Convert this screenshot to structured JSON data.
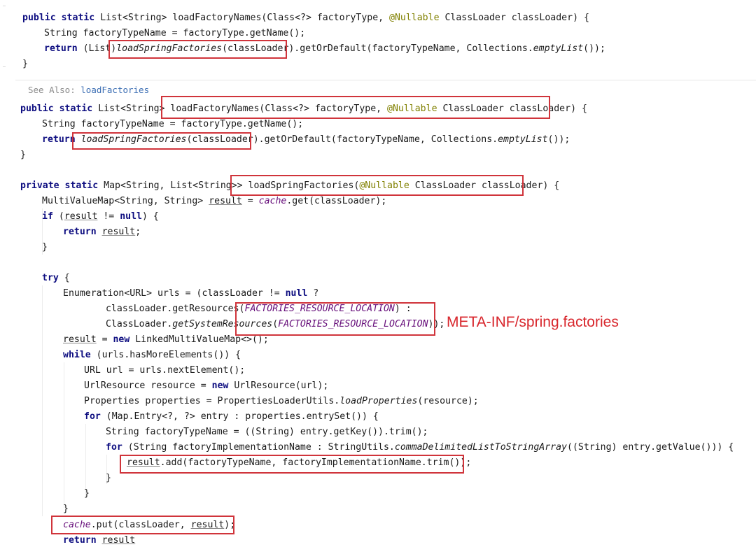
{
  "top_snippet": {
    "line1": {
      "kw1": "public",
      "kw2": "static",
      "sig_a": "List<String> loadFactoryNames(Class<?> factoryType, ",
      "ann": "@Nullable",
      "sig_b": " ClassLoader classLoader) {"
    },
    "line2": "String factoryTypeName = factoryType.getName();",
    "line3": {
      "kw": "return",
      "pre": " (List)",
      "call": "loadSpringFactories",
      "args": "(classLoader)",
      "post": ".getOrDefault(factoryTypeName, Collections.",
      "it": "emptyList",
      "end": "());"
    },
    "line4": "}"
  },
  "doc_hint": {
    "see_also": "See Also:",
    "link": "loadFactories"
  },
  "method1": {
    "line1": {
      "kw1": "public",
      "kw2": "static",
      "sig_a": "List<String> loadFactoryNames(Class<?> factoryType, ",
      "ann": "@Nullable",
      "sig_b": " ClassLoader classLoader) {"
    },
    "line2": "String factoryTypeName = factoryType.getName();",
    "line3": {
      "kw": "return",
      "call": "loadSpringFactories",
      "args": "(classLoader)",
      "post": ".getOrDefault(factoryTypeName, Collections.",
      "it": "emptyList",
      "end": "());"
    },
    "line4": "}"
  },
  "method2": {
    "decl": {
      "kw1": "private",
      "kw2": "static",
      "type": "Map<String, List<String>> loadSpringFactories(",
      "ann": "@Nullable",
      "end": " ClassLoader classLoader) {"
    },
    "l_cache_get": {
      "a": "MultiValueMap<String, String> ",
      "var": "result",
      "b": " = ",
      "fld": "cache",
      "c": ".get(classLoader);"
    },
    "l_if": {
      "kw": "if",
      "a": " (",
      "var": "result",
      "b": " != ",
      "kw2": "null",
      "c": ") {"
    },
    "l_return": {
      "kw": "return",
      "a": " ",
      "var": "result",
      "b": ";"
    },
    "l_close1": "}",
    "l_try": {
      "kw": "try",
      "a": " {"
    },
    "l_enum": {
      "a": "Enumeration<URL> urls = (classLoader != ",
      "kw": "null",
      "b": " ?"
    },
    "l_getres": {
      "a": "classLoader.getResources(",
      "const": "FACTORIES_RESOURCE_LOCATION",
      "b": ") :"
    },
    "l_getsys": {
      "a": "ClassLoader.",
      "it": "getSystemResources",
      "b": "(",
      "const": "FACTORIES_RESOURCE_LOCATION",
      "c": "));"
    },
    "l_newmap": {
      "var": "result",
      "a": " = ",
      "kw": "new",
      "b": " LinkedMultiValueMap<>();"
    },
    "l_while": {
      "kw": "while",
      "a": " (urls.hasMoreElements()) {"
    },
    "l_url": "URL url = urls.nextElement();",
    "l_res": {
      "a": "UrlResource resource = ",
      "kw": "new",
      "b": " UrlResource(url);"
    },
    "l_props": {
      "a": "Properties properties = PropertiesLoaderUtils.",
      "it": "loadProperties",
      "b": "(resource);"
    },
    "l_for1": {
      "kw": "for",
      "a": " (Map.Entry<?, ?> entry : properties.entrySet()) {"
    },
    "l_ftn": "String factoryTypeName = ((String) entry.getKey()).trim();",
    "l_for2": {
      "kw": "for",
      "a": " (String factoryImplementationName : StringUtils.",
      "it": "commaDelimitedListToStringArray",
      "b": "((String) entry.getValue())) {"
    },
    "l_add": {
      "var": "result",
      "a": ".add(factoryTypeName, factoryImplementationName.trim());"
    },
    "l_close2": "}",
    "l_close3": "}",
    "l_close4": "}",
    "l_put": {
      "fld": "cache",
      "a": ".put(classLoader, ",
      "var": "result",
      "b": ");"
    },
    "l_partial": {
      "kw": "return",
      "var": "result"
    }
  },
  "annotation": {
    "text": "META-INF/spring.factories",
    "color": "#d8262c"
  }
}
